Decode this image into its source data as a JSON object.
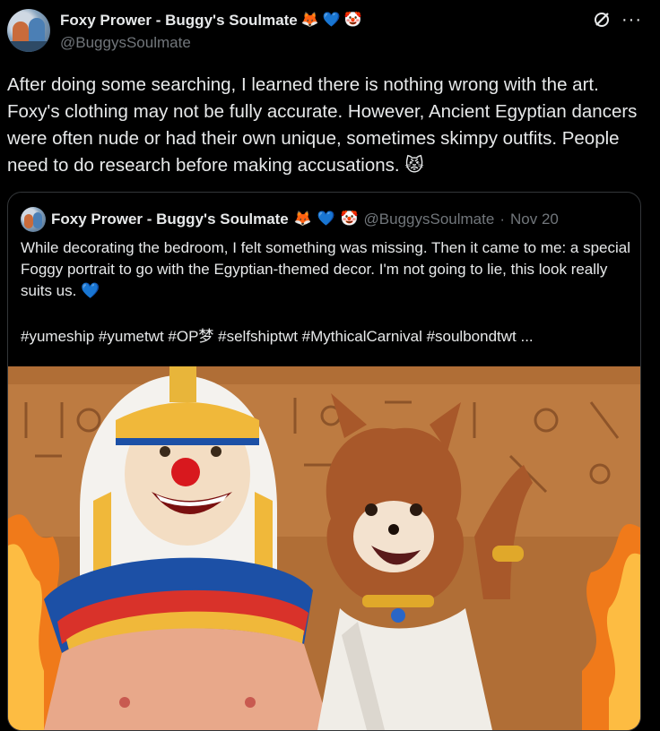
{
  "tweet": {
    "author_name": "Foxy Prower - Buggy's Soulmate",
    "author_emojis": [
      "🦊",
      "💙",
      "🤡"
    ],
    "handle": "@BuggysSoulmate",
    "text": "After doing some searching, I learned there is nothing wrong with the art. Foxy's clothing may not be fully accurate. However, Ancient Egyptian dancers were often nude or had their own unique, sometimes skimpy outfits. People need to do research before making accusations.",
    "text_emoji": "😾"
  },
  "quoted_tweet": {
    "author_name": "Foxy Prower - Buggy's Soulmate",
    "author_emojis": [
      "🦊",
      "💙",
      "🤡"
    ],
    "handle": "@BuggysSoulmate",
    "separator": "·",
    "date": "Nov 20",
    "text": "While decorating the bedroom, I felt something was missing. Then it came to me: a special Foggy portrait to go with the Egyptian-themed decor. I'm not going to lie, this look really suits us.",
    "text_emoji": "💙",
    "hashtags": "#yumeship #yumetwt #OP梦 #selfshiptwt #MythicalCarnival #soulbondtwt ..."
  },
  "icons": {
    "grok": "grok-icon",
    "more": "more-icon"
  },
  "colors": {
    "background": "#000000",
    "text": "#e7e9ea",
    "secondary": "#71767b",
    "border": "#333639"
  }
}
